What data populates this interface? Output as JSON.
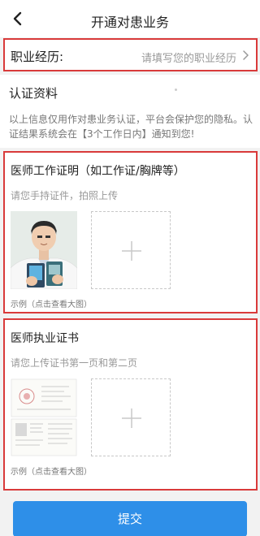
{
  "header": {
    "back_icon": "chevron-left-icon",
    "title": "开通对患业务"
  },
  "career": {
    "label": "职业经历:",
    "placeholder": "请填写您的职业经历",
    "arrow_icon": "chevron-right-icon"
  },
  "certification": {
    "title": "认证资料",
    "description": "以上信息仅用作对患业务认证，平台会保护您的隐私。认证结果系统会在【3个工作日内】通知到您!"
  },
  "work_proof": {
    "title": "医师工作证明（如工作证/胸牌等）",
    "hint": "请您手持证件，拍照上传",
    "sample_caption": "示例（点击查看大图）",
    "upload_icon": "plus-icon"
  },
  "license": {
    "title": "医师执业证书",
    "hint": "请您上传证书第一页和第二页",
    "sample_caption": "示例（点击查看大图）",
    "upload_icon": "plus-icon"
  },
  "submit_label": "提交",
  "colors": {
    "accent": "#2e8fe8",
    "highlight_border": "#d93a3a"
  }
}
